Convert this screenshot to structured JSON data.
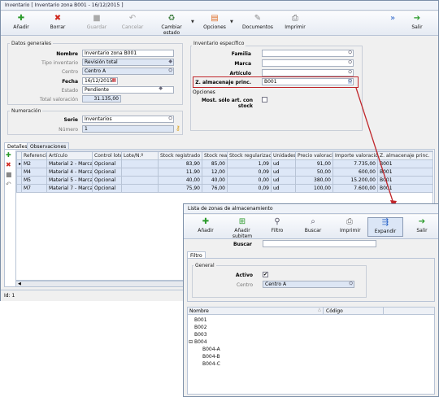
{
  "window": {
    "title": "Inventario  [ Inventario zona B001 - 16/12/2015 ]",
    "status": "Id: 1"
  },
  "toolbar": {
    "add": "Añadir",
    "delete": "Borrar",
    "save": "Guardar",
    "cancel": "Cancelar",
    "change_state": "Cambiar estado",
    "options": "Opciones",
    "documents": "Documentos",
    "print": "Imprimir",
    "exit": "Salir"
  },
  "general": {
    "title": "Datos generales",
    "nombre_label": "Nombre",
    "nombre_value": "Inventario zona B001",
    "tipo_label": "Tipo inventario",
    "tipo_value": "Revisión total",
    "centro_label": "Centro",
    "centro_value": "Centro A",
    "fecha_label": "Fecha",
    "fecha_value": "16/12/2015",
    "estado_label": "Estado",
    "estado_value": "Pendiente",
    "total_label": "Total valoración",
    "total_value": "31.135,00"
  },
  "numeracion": {
    "title": "Numeración",
    "serie_label": "Serie",
    "serie_value": "Inventarios",
    "numero_label": "Número",
    "numero_value": "1"
  },
  "especifico": {
    "title": "Inventario específico",
    "familia_label": "Familia",
    "marca_label": "Marca",
    "articulo_label": "Artículo",
    "zona_label": "Z. almacenaje princ.",
    "zona_value": "B001",
    "opciones_title": "Opciones",
    "mostrar_label": "Most. sólo art. con stock"
  },
  "tabs": {
    "detalles": "Detalles",
    "observaciones": "Observaciones"
  },
  "grid": {
    "columns": [
      "Referencia",
      "Artículo",
      "Control lote...",
      "Lote/N.º",
      "Stock registrado",
      "Stock real",
      "Stock regularización",
      "Unidades",
      "Precio valoración",
      "Importe valoración",
      "Z. almacenaje princ."
    ],
    "rows": [
      [
        "M2",
        "Material 2 - Marca 5",
        "Opcional",
        "",
        "83,90",
        "85,00",
        "1,09",
        "ud",
        "91,00",
        "7.735,00",
        "B001"
      ],
      [
        "M4",
        "Material 4 - Marca 1",
        "Opcional",
        "",
        "11,90",
        "12,00",
        "0,09",
        "ud",
        "50,00",
        "600,00",
        "B001"
      ],
      [
        "M5",
        "Material 5 - Marca 4",
        "Opcional",
        "",
        "40,00",
        "40,00",
        "0,00",
        "ud",
        "380,00",
        "15.200,00",
        "B001"
      ],
      [
        "M7",
        "Material 7 - Marca 1",
        "Opcional",
        "",
        "75,90",
        "76,00",
        "0,09",
        "ud",
        "100,00",
        "7.600,00",
        "B001"
      ]
    ]
  },
  "popup": {
    "title": "Lista de zonas de almacenamiento",
    "toolbar": {
      "add": "Añadir",
      "add_subitem": "Añadir subitem",
      "filter": "Filtro",
      "search": "Buscar",
      "print": "Imprimir",
      "expand": "Expandir",
      "exit": "Salir"
    },
    "buscar_label": "Buscar",
    "filtro_tab": "Filtro",
    "general_title": "General",
    "activo_label": "Activo",
    "centro_label": "Centro",
    "centro_value": "Centro A",
    "col_nombre": "Nombre",
    "col_codigo": "Código",
    "tree": [
      "B001",
      "B002",
      "B003",
      "B004",
      "B004-A",
      "B004-B",
      "B004-C"
    ]
  },
  "colors": {
    "accent_red": "#c0262b",
    "selected_row": "#dde7f7",
    "readonly_field": "#dde6f4"
  }
}
